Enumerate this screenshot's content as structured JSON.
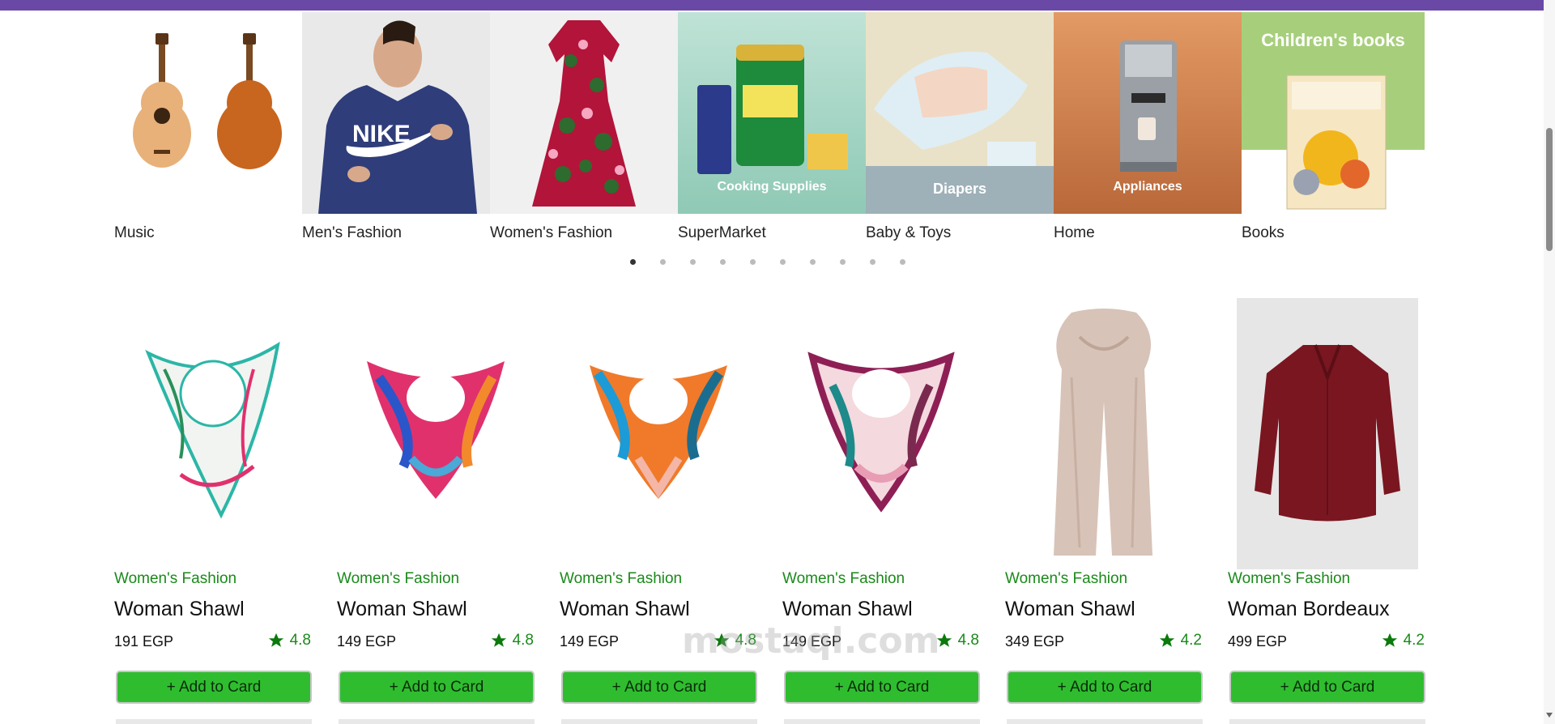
{
  "categories": [
    {
      "label": "Music",
      "icon": "guitar-icon"
    },
    {
      "label": "Men's Fashion",
      "icon": "hoodie-icon"
    },
    {
      "label": "Women's Fashion",
      "icon": "dress-icon"
    },
    {
      "label": "SuperMarket",
      "icon": "grocery-icon",
      "overlay": "Cooking Supplies"
    },
    {
      "label": "Baby & Toys",
      "icon": "diapers-icon",
      "overlay": "Diapers"
    },
    {
      "label": "Home",
      "icon": "coffee-machine-icon",
      "overlay": "Appliances"
    },
    {
      "label": "Books",
      "icon": "book-icon",
      "overlay": "Children's books"
    }
  ],
  "slider_dots": {
    "count": 10,
    "active": 0
  },
  "products": [
    {
      "category": "Women's Fashion",
      "name": "Woman Shawl",
      "price": "191 EGP",
      "rating": "4.8",
      "button": "+ Add to Card",
      "accent": "#2bb6a7"
    },
    {
      "category": "Women's Fashion",
      "name": "Woman Shawl",
      "price": "149 EGP",
      "rating": "4.8",
      "button": "+ Add to Card",
      "accent": "#e0316d"
    },
    {
      "category": "Women's Fashion",
      "name": "Woman Shawl",
      "price": "149 EGP",
      "rating": "4.8",
      "button": "+ Add to Card",
      "accent": "#f07a2a"
    },
    {
      "category": "Women's Fashion",
      "name": "Woman Shawl",
      "price": "149 EGP",
      "rating": "4.8",
      "button": "+ Add to Card",
      "accent": "#8e1f55"
    },
    {
      "category": "Women's Fashion",
      "name": "Woman Shawl",
      "price": "349 EGP",
      "rating": "4.2",
      "button": "+ Add to Card",
      "accent": "#d8c3b8"
    },
    {
      "category": "Women's Fashion",
      "name": "Woman Bordeaux",
      "price": "499 EGP",
      "rating": "4.2",
      "button": "+ Add to Card",
      "accent": "#7a1620"
    }
  ],
  "watermark": "mostaql.com",
  "colors": {
    "topbar": "#6a49a6",
    "brand_green": "#1a8a1a",
    "button_green": "#2fbd2f"
  }
}
